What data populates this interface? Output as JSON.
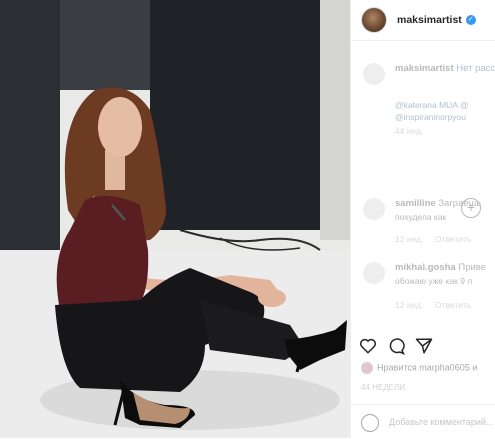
{
  "post": {
    "image_alt": "Woman in burgundy top and black trousers sitting on studio floor in high heels",
    "header_username": "maksimartist",
    "caption_username": "maksimartist",
    "caption_text": "Нет расстояни",
    "caption_line2": "@katerana MUA @",
    "caption_line3": "@inspiraninorpyou",
    "caption_time": "44 нед."
  },
  "comments": [
    {
      "username": "samilline",
      "text_line1": "Заграешь",
      "text_line2": "похудела как",
      "time": "12 нед.",
      "reply": "Ответить"
    },
    {
      "username": "mikhal.gosha",
      "text_line1": "Приве",
      "text_line2": "обожаю уже как 9 л",
      "time": "12 нед.",
      "reply": "Ответить"
    }
  ],
  "likes": {
    "text": "Нравится marpha0605 и"
  },
  "post_age": "44 НЕДЕЛИ",
  "comment_box": {
    "placeholder": "Добавьте комментарий..."
  },
  "colors": {
    "verified": "#3897f0",
    "top": "#5a1d21",
    "trousers": "#161618",
    "hair": "#6d3a22"
  }
}
